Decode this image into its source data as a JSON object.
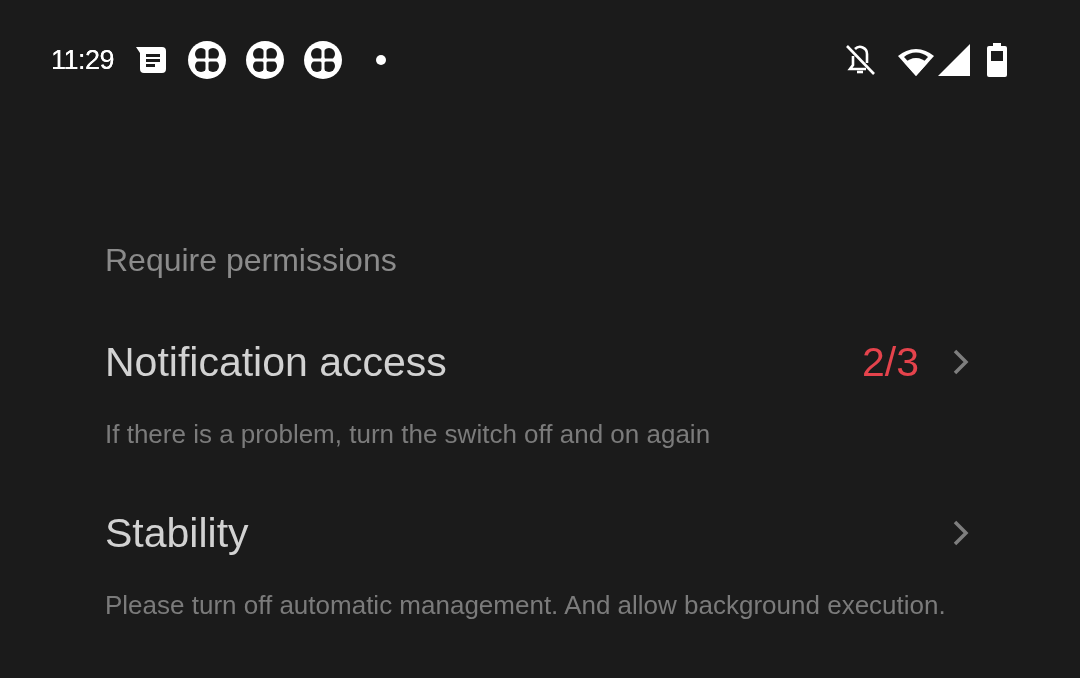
{
  "status_bar": {
    "time": "11:29"
  },
  "section": {
    "title": "Require permissions"
  },
  "items": [
    {
      "title": "Notification access",
      "count": "2/3",
      "subtitle": "If there is a problem, turn the switch off and on again"
    },
    {
      "title": "Stability",
      "subtitle": "Please turn off automatic management. And allow background execution."
    }
  ]
}
